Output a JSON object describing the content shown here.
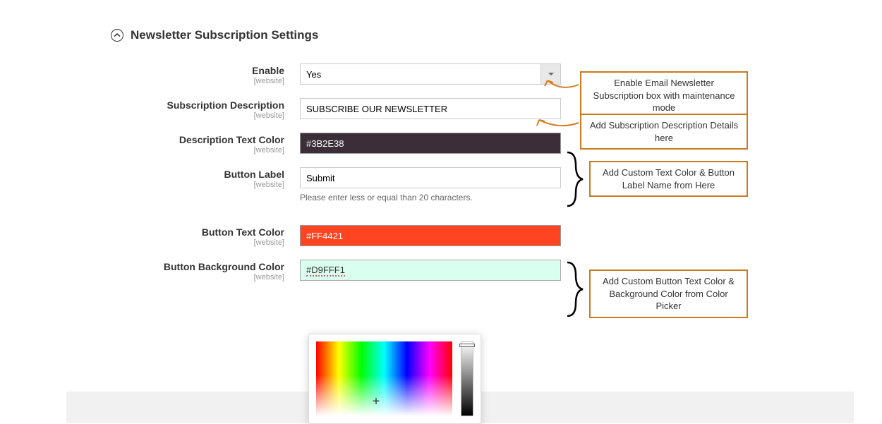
{
  "section": {
    "title": "Newsletter Subscription Settings"
  },
  "scope": "[website]",
  "fields": {
    "enable": {
      "label": "Enable",
      "value": "Yes"
    },
    "subscription_description": {
      "label": "Subscription Description",
      "value": "SUBSCRIBE OUR NEWSLETTER"
    },
    "description_text_color": {
      "label": "Description Text Color",
      "value": "#3B2E38"
    },
    "button_label": {
      "label": "Button Label",
      "value": "Submit",
      "hint": "Please enter less or equal than 20 characters."
    },
    "button_text_color": {
      "label": "Button Text Color",
      "value": "#FF4421"
    },
    "button_background_color": {
      "label": "Button Background Color",
      "value": "#D9FFF1"
    }
  },
  "callouts": {
    "enable": "Enable Email Newsletter Subscription box with maintenance mode",
    "desc": "Add Subscription Description Details here",
    "text_color_group": "Add Custom Text Color & Button Label Name from Here",
    "button_color_group": "Add Custom Button Text Color & Background Color from Color Picker"
  }
}
